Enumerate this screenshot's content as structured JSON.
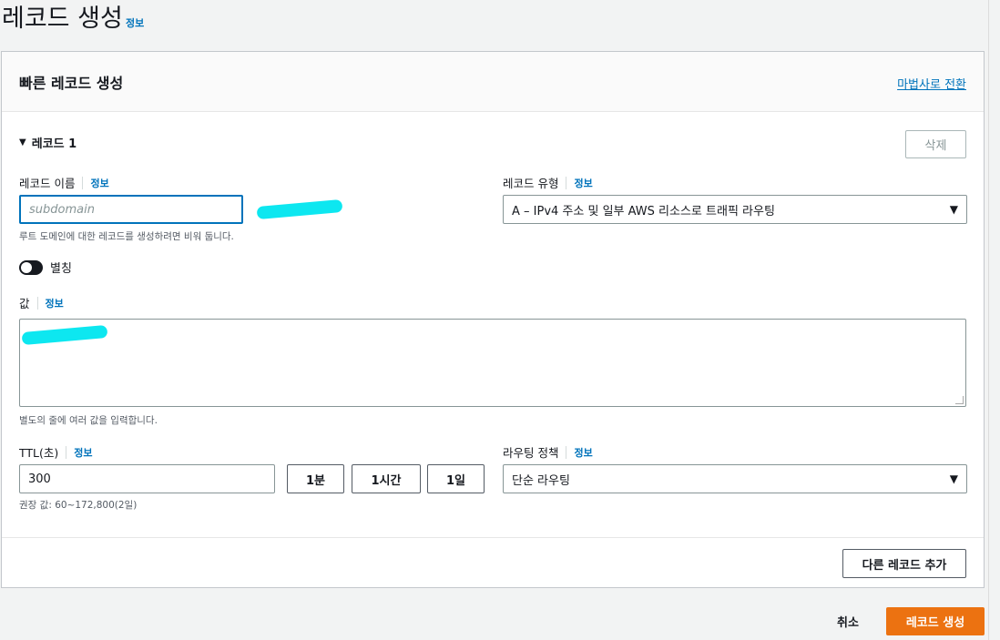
{
  "page": {
    "title": "레코드 생성",
    "info": "정보"
  },
  "panel": {
    "title": "빠른 레코드 생성",
    "wizard_link": "마법사로 전환",
    "record": {
      "heading": "레코드 1",
      "delete_label": "삭제",
      "name": {
        "label": "레코드 이름",
        "info": "정보",
        "placeholder": "subdomain",
        "hint": "루트 도메인에 대한 레코드를 생성하려면 비워 둡니다."
      },
      "type": {
        "label": "레코드 유형",
        "info": "정보",
        "value": "A – IPv4 주소 및 일부 AWS 리소스로 트래픽 라우팅"
      },
      "alias": {
        "label": "별칭",
        "enabled": false
      },
      "value": {
        "label": "값",
        "info": "정보",
        "hint": "별도의 줄에 여러 값을 입력합니다."
      },
      "ttl": {
        "label": "TTL(초)",
        "info": "정보",
        "value": "300",
        "hint": "권장 값: 60~172,800(2일)",
        "presets": [
          "1분",
          "1시간",
          "1일"
        ]
      },
      "routing": {
        "label": "라우팅 정책",
        "info": "정보",
        "value": "단순 라우팅"
      }
    },
    "add_record_label": "다른 레코드 추가"
  },
  "footer": {
    "cancel_label": "취소",
    "create_label": "레코드 생성"
  },
  "colors": {
    "accent": "#0073bb",
    "primary_button": "#ec7211",
    "redaction": "#00e6ef"
  }
}
